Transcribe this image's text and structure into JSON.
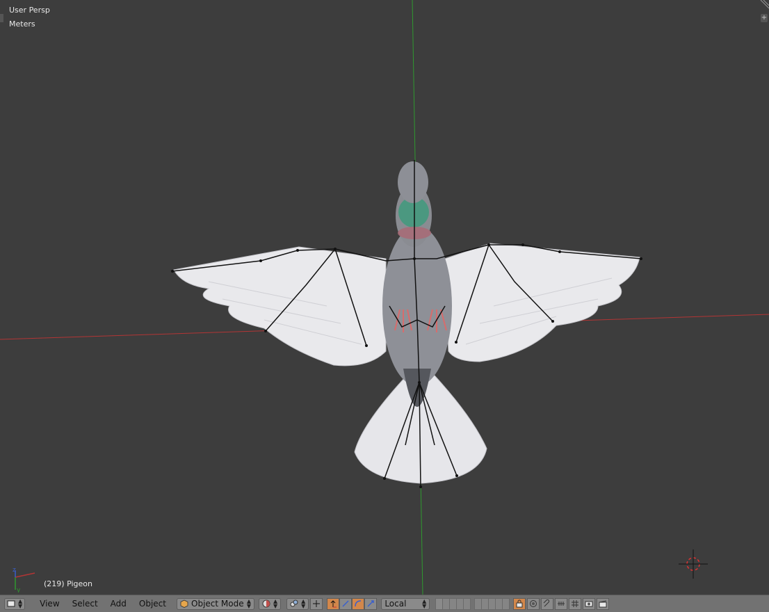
{
  "viewport": {
    "view_name": "User Persp",
    "units": "Meters",
    "object_info": "(219) Pigeon",
    "corner_plus": "+"
  },
  "gizmo": {
    "z_label": "z",
    "y_label": "y"
  },
  "header": {
    "menus": {
      "view": "View",
      "select": "Select",
      "add": "Add",
      "object": "Object"
    },
    "mode": "Object Mode",
    "orientation": "Local"
  },
  "colors": {
    "viewport_bg": "#3d3d3d",
    "header_bg": "#727272",
    "x_axis": "#b33535",
    "y_axis": "#2f9a2f",
    "active_button": "#d2874b"
  }
}
